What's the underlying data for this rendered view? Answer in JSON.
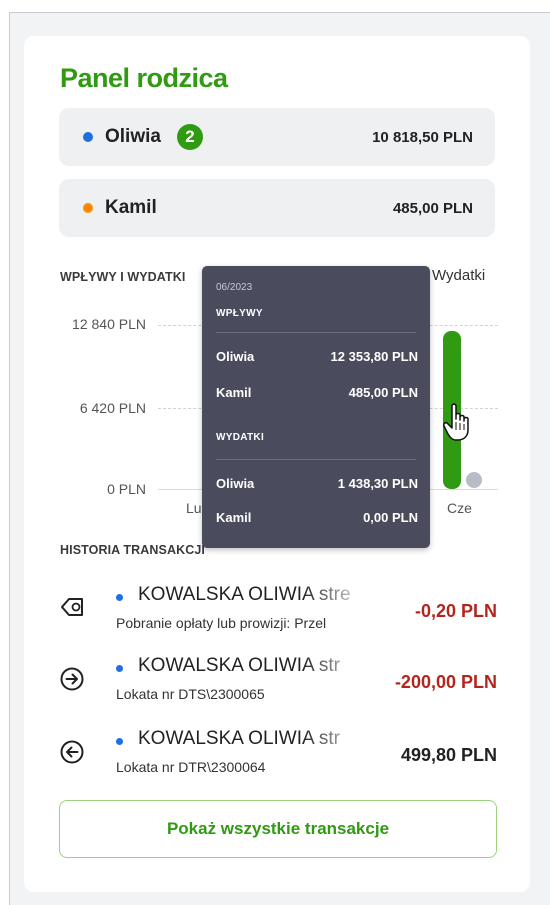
{
  "panel": {
    "title": "Panel rodzica"
  },
  "children": [
    {
      "name": "Oliwia",
      "badge": "2",
      "amount": "10 818,50 PLN",
      "color": "#1f6fe0"
    },
    {
      "name": "Kamil",
      "amount": "485,00 PLN",
      "color": "#ff8a00"
    }
  ],
  "chart": {
    "section_label": "WPŁYWY I WYDATKI",
    "legend_visible": "Wydatki",
    "yticks": [
      "12 840 PLN",
      "6 420 PLN",
      "0 PLN"
    ],
    "xticks": [
      "Lu",
      "Cze"
    ]
  },
  "chart_data": {
    "type": "bar",
    "categories": [
      "Lu",
      "Cze"
    ],
    "ylim": [
      0,
      12840
    ],
    "grid": true,
    "series": [
      {
        "name": "Wydatki",
        "values": [
          null,
          12353.8
        ]
      }
    ]
  },
  "tooltip": {
    "period": "06/2023",
    "inflows_header": "WPŁYWY",
    "inflows": [
      {
        "name": "Oliwia",
        "value": "12 353,80 PLN"
      },
      {
        "name": "Kamil",
        "value": "485,00 PLN"
      }
    ],
    "expenses_header": "WYDATKI",
    "expenses": [
      {
        "name": "Oliwia",
        "value": "1 438,30 PLN"
      },
      {
        "name": "Kamil",
        "value": "0,00 PLN"
      }
    ]
  },
  "history": {
    "section_label": "HISTORIA TRANSAKCJI",
    "items": [
      {
        "payee": "KOWALSKA OLIWIA stre",
        "desc": "Pobranie opłaty lub prowizji: Przel",
        "amount": "-0,20 PLN",
        "icon": "fee-tag-icon"
      },
      {
        "payee": "KOWALSKA OLIWIA str",
        "desc": "Lokata nr DTS\\2300065",
        "amount": "-200,00 PLN",
        "icon": "arrow-right-circle-icon"
      },
      {
        "payee": "KOWALSKA OLIWIA str",
        "desc": "Lokata nr DTR\\2300064",
        "amount": "499,80 PLN",
        "icon": "arrow-left-circle-icon"
      }
    ],
    "show_all_label": "Pokaż wszystkie transakcje"
  },
  "colors": {
    "brand_green": "#2f9a12",
    "negative": "#b3261e",
    "positive": "#222222"
  }
}
